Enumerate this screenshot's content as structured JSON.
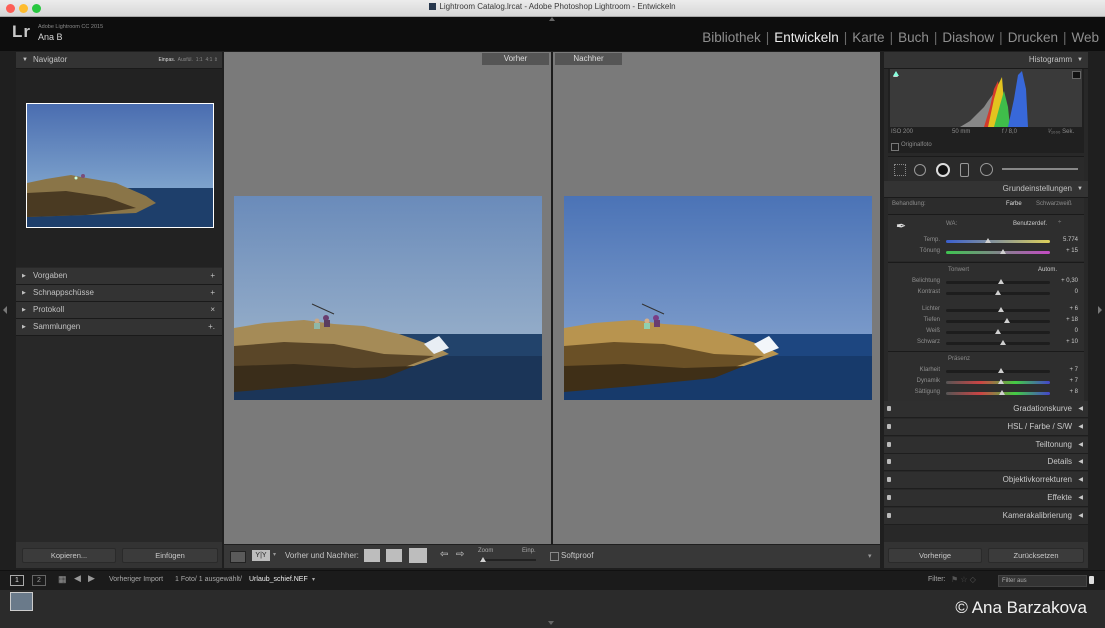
{
  "window": {
    "title": "Lightroom Catalog.lrcat - Adobe Photoshop Lightroom - Entwickeln"
  },
  "identity": {
    "logo": "Lr",
    "version": "Adobe Lightroom CC 2015",
    "user": "Ana B"
  },
  "modules": [
    "Bibliothek",
    "Entwickeln",
    "Karte",
    "Buch",
    "Diashow",
    "Drucken",
    "Web"
  ],
  "left": {
    "navigator": {
      "title": "Navigator",
      "zoom_options": [
        "Einpas.",
        "Ausfül.",
        "1:1",
        "4:1"
      ]
    },
    "panels": [
      {
        "label": "Vorgaben",
        "action": "+"
      },
      {
        "label": "Schnappschüsse",
        "action": "+"
      },
      {
        "label": "Protokoll",
        "action": "×"
      },
      {
        "label": "Sammlungen",
        "action": "+."
      }
    ],
    "copy_button": "Kopieren...",
    "paste_button": "Einfügen"
  },
  "center": {
    "before_label": "Vorher",
    "after_label": "Nachher",
    "compare_label": "Vorher und Nachher:",
    "zoom_label": "Zoom",
    "zoom_value": "Einp.",
    "softproof_label": "Softproof",
    "yy_label": "Y|Y"
  },
  "right": {
    "histogram": {
      "title": "Histogramm",
      "iso": "ISO 200",
      "focal": "50 mm",
      "aperture": "f / 8,0",
      "shutter": "¹⁄₁₀₀₀ Sek.",
      "original_label": "Originalfoto"
    },
    "basic": {
      "title": "Grundeinstellungen",
      "treatment_label": "Behandlung:",
      "color_option": "Farbe",
      "bw_option": "Schwarzweiß",
      "wb_label": "WA:",
      "wb_value": "Benutzerdef.",
      "sliders_wb": [
        {
          "label": "Temp.",
          "value": "5.774",
          "level": 0.4
        },
        {
          "label": "Tönung",
          "value": "+ 15",
          "level": 0.55
        }
      ],
      "tone_label": "Tonwert",
      "auto_label": "Autom.",
      "sliders_tone": [
        {
          "label": "Belichtung",
          "value": "+ 0,30",
          "level": 0.53
        },
        {
          "label": "Kontrast",
          "value": "0",
          "level": 0.5
        }
      ],
      "sliders_tone2": [
        {
          "label": "Lichter",
          "value": "+ 6",
          "level": 0.53
        },
        {
          "label": "Tiefen",
          "value": "+ 18",
          "level": 0.59
        },
        {
          "label": "Weiß",
          "value": "0",
          "level": 0.5
        },
        {
          "label": "Schwarz",
          "value": "+ 10",
          "level": 0.55
        }
      ],
      "presence_label": "Präsenz",
      "sliders_presence": [
        {
          "label": "Klarheit",
          "value": "+ 7",
          "level": 0.53
        },
        {
          "label": "Dynamik",
          "value": "+ 7",
          "level": 0.53
        },
        {
          "label": "Sättigung",
          "value": "+ 8",
          "level": 0.54
        }
      ]
    },
    "sections": [
      "Gradationskurve",
      "HSL / Farbe / S/W",
      "Teiltonung",
      "Details",
      "Objektivkorrekturen",
      "Effekte",
      "Kamerakalibrierung"
    ],
    "previous_button": "Vorherige",
    "reset_button": "Zurücksetzen"
  },
  "filmstrip": {
    "view1": "1",
    "view2": "2",
    "source": "Vorheriger Import",
    "count": "1 Foto/ 1 ausgewählt/",
    "filename": "Urlaub_schief.NEF",
    "filter_label": "Filter:",
    "filter_value": "Filter aus"
  },
  "watermark": "© Ana Barzakova"
}
